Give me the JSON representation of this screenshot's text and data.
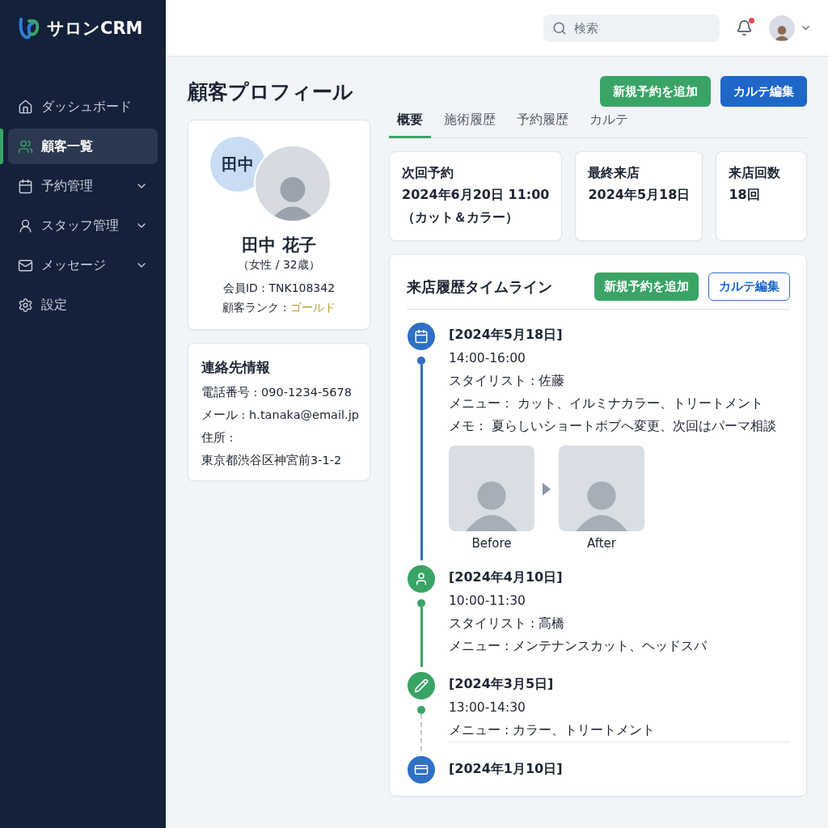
{
  "brand": {
    "name": "サロンCRM"
  },
  "sidebar": {
    "items": [
      {
        "kind": "home",
        "label": "ダッシュボード",
        "selected": false,
        "expandable": false
      },
      {
        "kind": "users",
        "label": "顧客一覧",
        "selected": true,
        "expandable": false
      },
      {
        "kind": "calendar",
        "label": "予約管理",
        "selected": false,
        "expandable": true
      },
      {
        "kind": "staff",
        "label": "スタッフ管理",
        "selected": false,
        "expandable": true
      },
      {
        "kind": "mail",
        "label": "メッセージ",
        "selected": false,
        "expandable": true
      },
      {
        "kind": "settings",
        "label": "設定",
        "selected": false,
        "expandable": false
      }
    ]
  },
  "header": {
    "search": {
      "placeholder": "検索"
    },
    "notification": {
      "unread": true
    }
  },
  "page": {
    "title": "顧客プロフィール",
    "actions": [
      {
        "kind": "primary",
        "label": "新規予約を追加"
      },
      {
        "kind": "secondary",
        "label": "カルテ編集"
      }
    ]
  },
  "profile": {
    "initials": "田中",
    "name": "田中 花子",
    "meta": "（女性 / 32歳）",
    "member_id": "会員ID : TNK108342",
    "rank_label": "顧客ランク :",
    "rank_value": "ゴールド"
  },
  "contact": {
    "title": "連絡先情報",
    "rows": [
      "電話番号 : 090-1234-5678",
      "メール : h.tanaka@email.jp",
      "住所 :",
      "東京都渋谷区神宮前3-1-2"
    ]
  },
  "tabs": [
    {
      "label": "概要",
      "selected": true
    },
    {
      "label": "施術履歴",
      "selected": false
    },
    {
      "label": "予約履歴",
      "selected": false
    },
    {
      "label": "カルテ",
      "selected": false
    }
  ],
  "stats": [
    {
      "label": "次回予約",
      "lines": [
        "2024年6月20日 11:00",
        "（カット＆カラー）"
      ]
    },
    {
      "label": "最終来店",
      "lines": [
        "2024年5月18日"
      ]
    },
    {
      "label": "来店回数",
      "lines": [
        "18回"
      ]
    }
  ],
  "timeline": {
    "title": "来店履歴タイムライン",
    "actions": [
      {
        "kind": "primary",
        "label": "新規予約を追加"
      },
      {
        "kind": "outline",
        "label": "カルテ編集"
      }
    ],
    "entries": [
      {
        "kind": "calendar",
        "color": "#2f6fc6",
        "date": "[2024年5月18日]",
        "lines": [
          "14:00-16:00",
          "スタイリスト : 佐藤",
          "メニュー： カット、イルミナカラー、トリートメント",
          "メモ： 夏らしいショートボブへ変更、次回はパーマ相談"
        ],
        "photos": [
          "Before",
          "After"
        ]
      },
      {
        "kind": "user",
        "color": "#3aa466",
        "date": "[2024年4月10日]",
        "lines": [
          "10:00-11:30",
          "スタイリスト : 高橋",
          "メニュー : メンテナンスカット、ヘッドスパ"
        ]
      },
      {
        "kind": "pencil",
        "color": "#3aa466",
        "date": "[2024年3月5日]",
        "lines": [
          "13:00-14:30",
          "メニュー : カラー、トリートメント"
        ]
      },
      {
        "kind": "card",
        "color": "#2f6fc6",
        "date": "[2024年1月10日]"
      }
    ]
  }
}
